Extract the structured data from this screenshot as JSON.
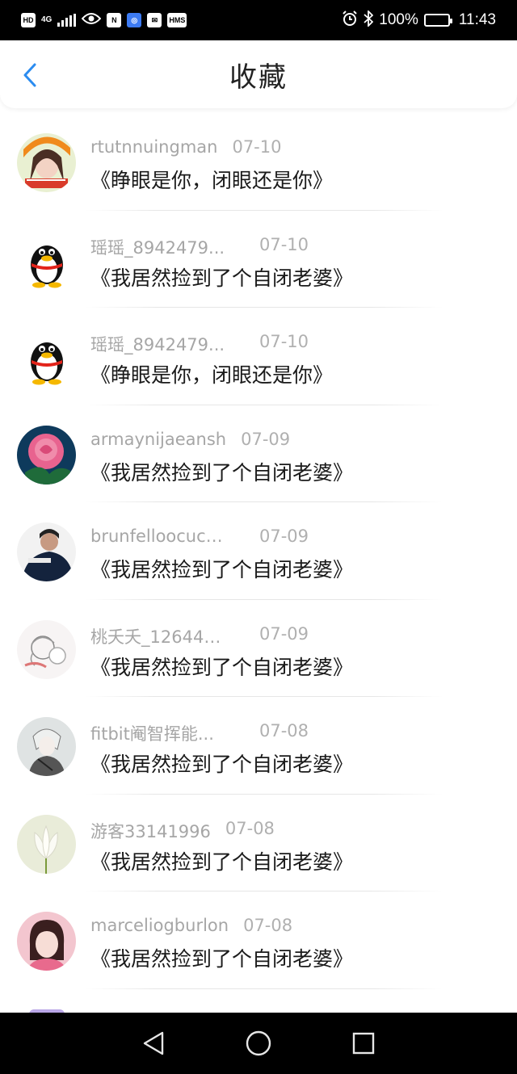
{
  "status_bar": {
    "hd": "HD",
    "network": "4G",
    "n_badge": "N",
    "hms": "HMS",
    "battery": "100%",
    "time": "11:43"
  },
  "header": {
    "title": "收藏",
    "accent": "#2b8cf0"
  },
  "items": [
    {
      "user": "rtutnnuingman",
      "date": "07-10",
      "book": "《睁眼是你，闭眼还是你》",
      "avatar": "avatar-girl-orange"
    },
    {
      "user": "瑶瑶_8942479...",
      "date": "07-10",
      "book": "《我居然捡到了个自闭老婆》",
      "avatar": "avatar-qq-penguin"
    },
    {
      "user": "瑶瑶_8942479...",
      "date": "07-10",
      "book": "《睁眼是你，闭眼还是你》",
      "avatar": "avatar-qq-penguin"
    },
    {
      "user": "armaynijaeansh",
      "date": "07-09",
      "book": "《我居然捡到了个自闭老婆》",
      "avatar": "avatar-pink-rose"
    },
    {
      "user": "brunfelloocucq...",
      "date": "07-09",
      "book": "《我居然捡到了个自闭老婆》",
      "avatar": "avatar-man-navy"
    },
    {
      "user": "桃夭夭_126442...",
      "date": "07-09",
      "book": "《我居然捡到了个自闭老婆》",
      "avatar": "avatar-anime-sketch"
    },
    {
      "user": "fitbit阉智挥能...",
      "date": "07-08",
      "book": "《我居然捡到了个自闭老婆》",
      "avatar": "avatar-anime-grey"
    },
    {
      "user": "游客33141996",
      "date": "07-08",
      "book": "《我居然捡到了个自闭老婆》",
      "avatar": "avatar-lotus"
    },
    {
      "user": "marceliogburlon",
      "date": "07-08",
      "book": "《我居然捡到了个自闭老婆》",
      "avatar": "avatar-girl-pink"
    }
  ]
}
